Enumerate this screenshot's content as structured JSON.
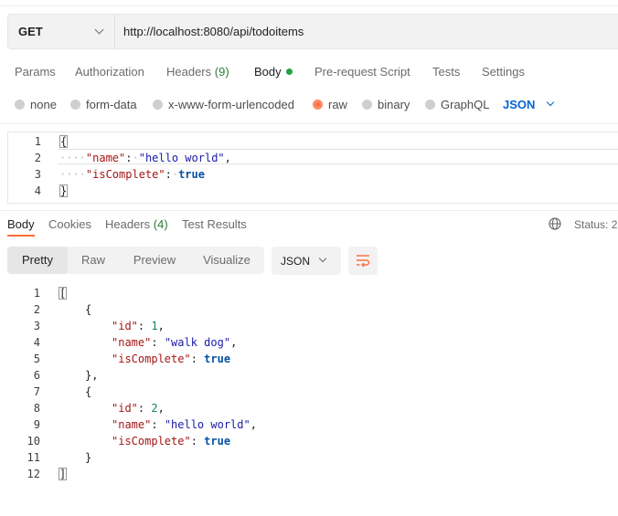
{
  "request": {
    "method": "GET",
    "url": "http://localhost:8080/api/todoitems"
  },
  "request_tabs": {
    "params": "Params",
    "authorization": "Authorization",
    "headers": "Headers",
    "headers_count": "(9)",
    "body": "Body",
    "pre_request_script": "Pre-request Script",
    "tests": "Tests",
    "settings": "Settings"
  },
  "body_types": {
    "none": "none",
    "form_data": "form-data",
    "urlencoded": "x-www-form-urlencoded",
    "raw": "raw",
    "binary": "binary",
    "graphql": "GraphQL",
    "selected": "raw",
    "language": "JSON"
  },
  "request_body": {
    "line_numbers": [
      "1",
      "2",
      "3",
      "4"
    ],
    "name_key": "\"name\"",
    "name_value": "\"hello world\"",
    "is_complete_key": "\"isComplete\"",
    "is_complete_value": "true"
  },
  "response_tabs": {
    "body": "Body",
    "cookies": "Cookies",
    "headers": "Headers",
    "headers_count": "(4)",
    "test_results": "Test Results",
    "status": "Status: 2"
  },
  "response_view": {
    "pretty": "Pretty",
    "raw": "Raw",
    "preview": "Preview",
    "visualize": "Visualize",
    "format": "JSON"
  },
  "response_body": {
    "line_numbers": [
      "1",
      "2",
      "3",
      "4",
      "5",
      "6",
      "7",
      "8",
      "9",
      "10",
      "11",
      "12"
    ],
    "items": [
      {
        "id_key": "\"id\"",
        "id": "1",
        "name_key": "\"name\"",
        "name": "\"walk dog\"",
        "is_complete_key": "\"isComplete\"",
        "is_complete": "true"
      },
      {
        "id_key": "\"id\"",
        "id": "2",
        "name_key": "\"name\"",
        "name": "\"hello world\"",
        "is_complete_key": "\"isComplete\"",
        "is_complete": "true"
      }
    ]
  },
  "colors": {
    "accent": "#ff6c37",
    "body_dot": "#25a244",
    "link_blue": "#0265d2"
  }
}
